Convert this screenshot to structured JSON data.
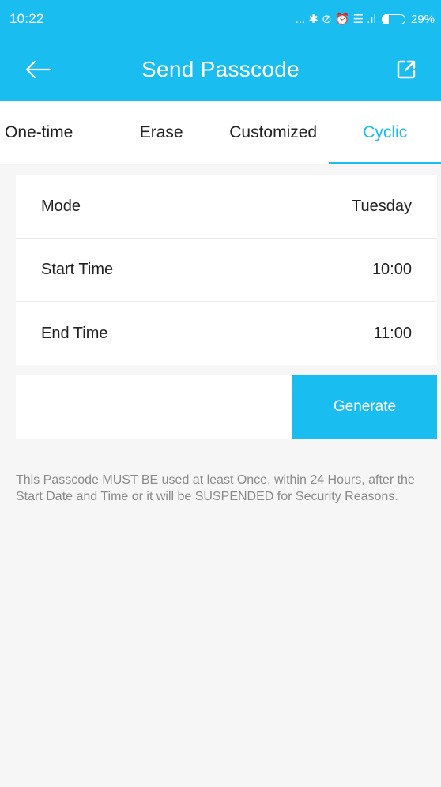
{
  "status_bar": {
    "time": "10:22",
    "icons_text": "... ✱ ⊘ ⏰ ☰ .ıl",
    "battery": "29%",
    "battery_level": 0.29
  },
  "appbar": {
    "title": "Send Passcode",
    "back_icon": "arrow-left-icon",
    "share_icon": "external-link-icon"
  },
  "tabs": [
    {
      "label": "One-time",
      "active": false
    },
    {
      "label": "Erase",
      "active": false
    },
    {
      "label": "Customized",
      "active": false
    },
    {
      "label": "Cyclic",
      "active": true
    }
  ],
  "settings": {
    "mode_label": "Mode",
    "mode_value": "Tuesday",
    "start_label": "Start Time",
    "start_value": "10:00",
    "end_label": "End Time",
    "end_value": "11:00"
  },
  "generate": {
    "field_value": "",
    "button_label": "Generate"
  },
  "notice": "This Passcode MUST BE used at least Once, within 24 Hours, after the Start Date and Time or it will be SUSPENDED for Security Reasons.",
  "colors": {
    "accent": "#19bdf0",
    "background": "#f6f6f6"
  }
}
